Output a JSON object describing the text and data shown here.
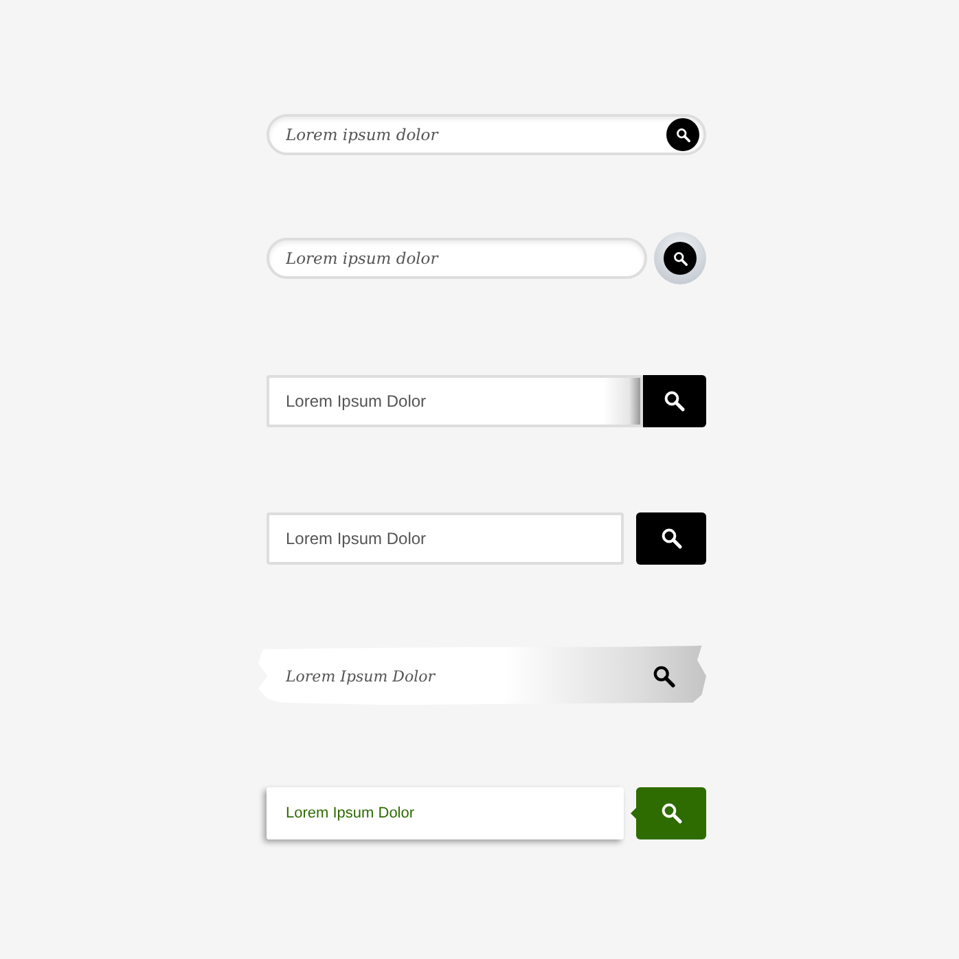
{
  "search_bars": [
    {
      "kind": "pill-inset",
      "placeholder": "Lorem ipsum dolor"
    },
    {
      "kind": "pill-detached",
      "placeholder": "Lorem ipsum dolor"
    },
    {
      "kind": "square-attached",
      "placeholder": "Lorem Ipsum Dolor"
    },
    {
      "kind": "square-detached",
      "placeholder": "Lorem Ipsum Dolor"
    },
    {
      "kind": "brush",
      "placeholder": "Lorem Ipsum Dolor"
    },
    {
      "kind": "green",
      "placeholder": "Lorem Ipsum Dolor"
    }
  ]
}
